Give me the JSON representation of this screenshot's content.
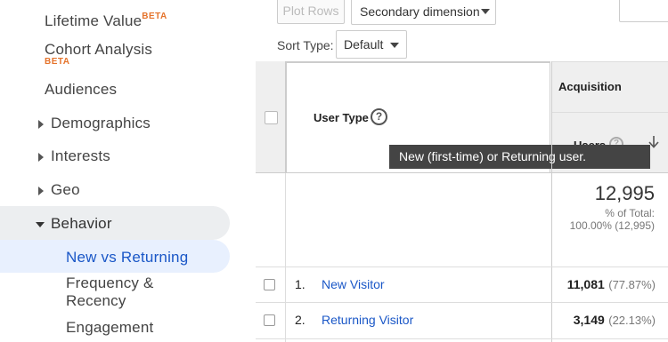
{
  "sidebar": {
    "lifetime_value": {
      "label": "Lifetime Value",
      "badge": "BETA"
    },
    "cohort_analysis": {
      "label": "Cohort Analysis",
      "badge": "BETA"
    },
    "audiences": {
      "label": "Audiences"
    },
    "demographics": {
      "label": "Demographics"
    },
    "interests": {
      "label": "Interests"
    },
    "geo": {
      "label": "Geo"
    },
    "behavior": {
      "label": "Behavior"
    },
    "new_vs_returning": {
      "label": "New vs Returning"
    },
    "frequency_recency": {
      "label_line1": "Frequency &",
      "label_line2": "Recency"
    },
    "engagement": {
      "label": "Engagement"
    }
  },
  "toolbar": {
    "plot_rows": "Plot Rows",
    "secondary_dimension": "Secondary dimension",
    "sort_type_label": "Sort Type:",
    "sort_type_value": "Default"
  },
  "table": {
    "dimension_header": "User Type",
    "group_header": "Acquisition",
    "metric_header": "Users",
    "tooltip": "New (first-time) or Returning user.",
    "totals": {
      "value": "12,995",
      "pct_label": "% of Total:",
      "pct_value": "100.00% (12,995)"
    },
    "rows": [
      {
        "index": "1.",
        "name": "New Visitor",
        "users": "11,081",
        "pct": "(77.87%)"
      },
      {
        "index": "2.",
        "name": "Returning Visitor",
        "users": "3,149",
        "pct": "(22.13%)"
      }
    ]
  },
  "colors": {
    "link": "#1a57c7",
    "beta": "#e5732b",
    "selected_bg": "#e8f0fe"
  }
}
